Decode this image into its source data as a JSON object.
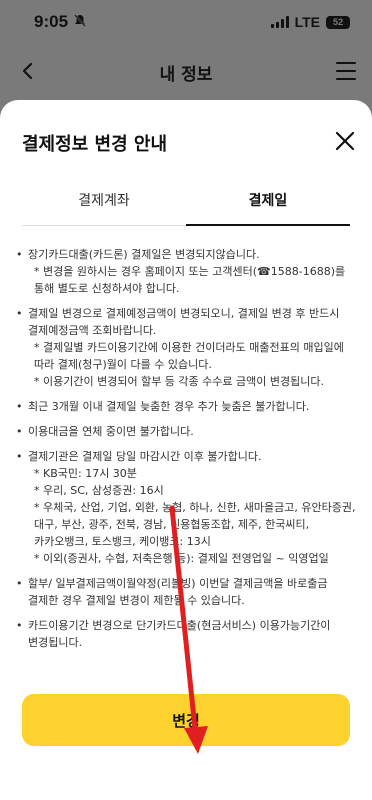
{
  "status_bar": {
    "time": "9:05",
    "network": "LTE",
    "battery": "52"
  },
  "header": {
    "title": "내 정보"
  },
  "sheet": {
    "title": "결제정보 변경 안내",
    "tabs": [
      {
        "label": "결제계좌",
        "active": false
      },
      {
        "label": "결제일",
        "active": true
      }
    ],
    "notices": [
      {
        "text": "장기카드대출(카드론) 결제일은 변경되지않습니다.",
        "sub": "* 변경을 원하시는 경우 홈페이지 또는 고객센터(☎1588-1688)를 통해 별도로 신청하셔야 합니다."
      },
      {
        "text": "결제일 변경으로 결제예정금액이 변경되오니, 결제일 변경 후 반드시 결제예정금액 조회바랍니다.",
        "sub": "* 결제일별 카드이용기간에 이용한 건이더라도 매출전표의 매입일에 따라 결제(청구)월이 다를 수 있습니다.",
        "sub2": "* 이용기간이 변경되어 할부 등 각종 수수료 금액이 변경됩니다."
      },
      {
        "text": "최근 3개월 이내 결제일 늦춤한 경우 추가 늦춤은 불가합니다."
      },
      {
        "text": "이용대금을 연체 중이면 불가합니다."
      },
      {
        "text": "결제기관은 결제일 당일 마감시간 이후 불가합니다.",
        "lines": [
          "* KB국민: 17시 30분",
          "* 우리, SC, 삼성증권: 16시",
          "* 우체국, 산업, 기업, 외환, 농협, 하나, 신한, 새마을금고, 유안타증권, 대구, 부산, 광주, 전북, 경남, 신용협동조합, 제주, 한국씨티, 카카오뱅크, 토스뱅크, 케이뱅크: 13시",
          "* 이외(증권사, 수협, 저축은행 등): 결제일 전영업일 ~ 익영업일"
        ]
      },
      {
        "text": "할부/ 일부결제금액이월약정(리볼빙) 이번달 결제금액을 바로출금 결제한 경우 결제일 변경이 제한될 수 있습니다."
      },
      {
        "text": "카드이용기간 변경으로 단기카드대출(현금서비스) 이용가능기간이 변경됩니다."
      }
    ],
    "button_label": "변경"
  },
  "colors": {
    "accent": "#fed22e",
    "overlay": "#7a7a7a",
    "annotation_arrow": "#e02020"
  }
}
